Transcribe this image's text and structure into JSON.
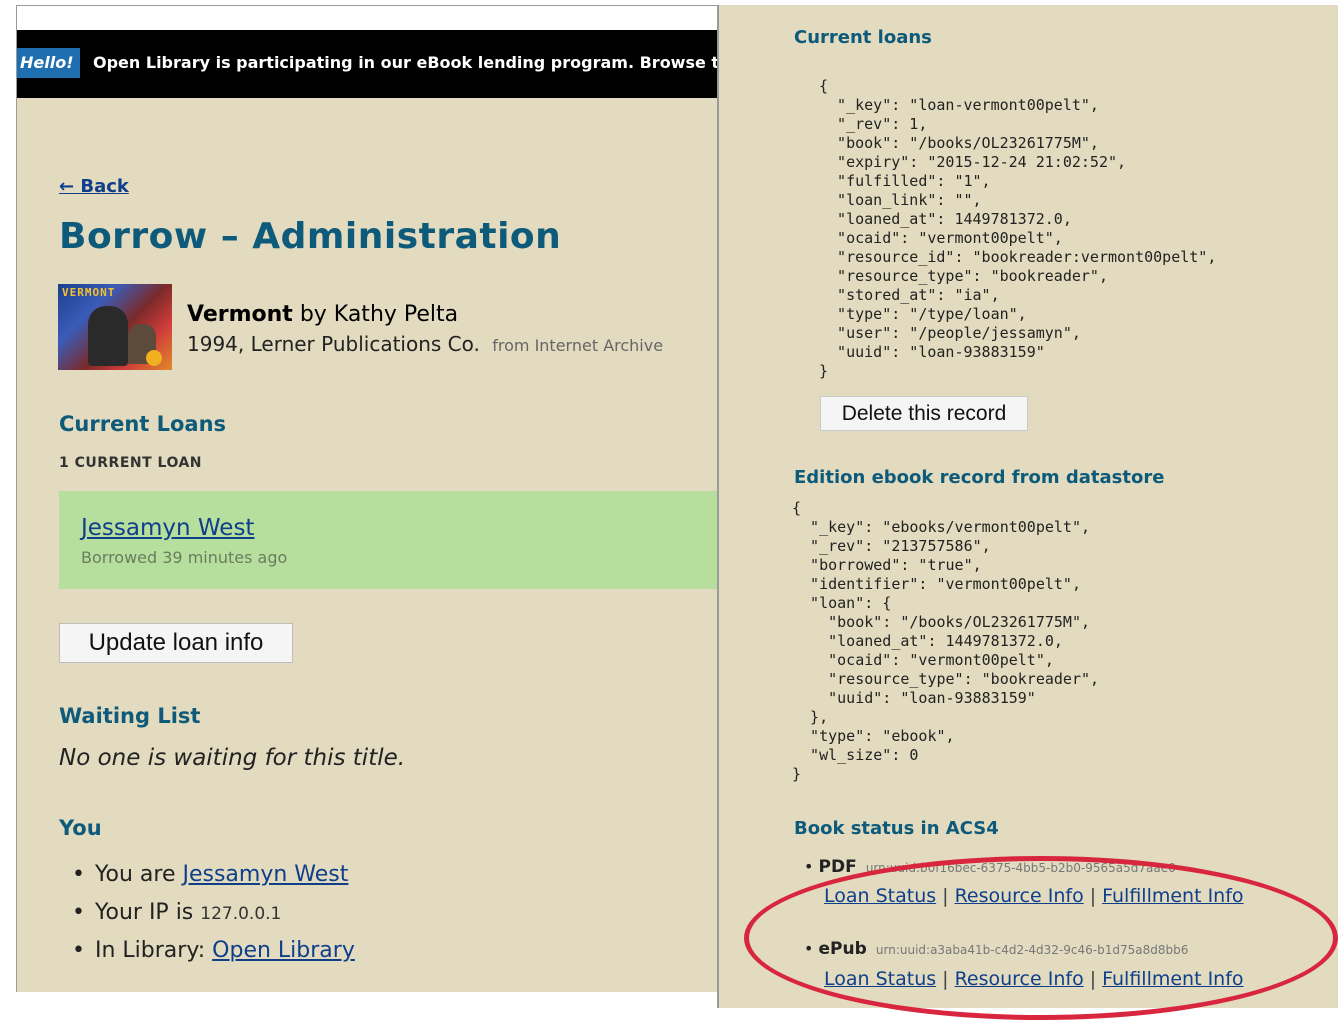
{
  "banner": {
    "hello": "Hello!",
    "message": "Open Library is participating in our eBook lending program. Browse th"
  },
  "nav": {
    "back": "← Back"
  },
  "page_title": "Borrow – Administration",
  "book": {
    "title": "Vermont",
    "by": "by Kathy Pelta",
    "publication": "1994, Lerner Publications Co.",
    "source": "from Internet Archive",
    "cover_text": "VERMONT"
  },
  "current_loans": {
    "heading": "Current Loans",
    "count": "1 CURRENT LOAN",
    "loan": {
      "user": "Jessamyn West",
      "time": "Borrowed 39 minutes ago"
    },
    "update_button": "Update loan info"
  },
  "waiting": {
    "heading": "Waiting List",
    "message": "No one is waiting for this title."
  },
  "you": {
    "heading": "You",
    "items": [
      {
        "prefix": "You are",
        "link": "Jessamyn West"
      },
      {
        "prefix": "Your IP is",
        "value": "127.0.0.1"
      },
      {
        "prefix": "In Library:",
        "link": "Open Library"
      }
    ]
  },
  "right": {
    "current_loans_heading": "Current loans",
    "loan_record": "{\n  \"_key\": \"loan-vermont00pelt\",\n  \"_rev\": 1,\n  \"book\": \"/books/OL23261775M\",\n  \"expiry\": \"2015-12-24 21:02:52\",\n  \"fulfilled\": \"1\",\n  \"loan_link\": \"\",\n  \"loaned_at\": 1449781372.0,\n  \"ocaid\": \"vermont00pelt\",\n  \"resource_id\": \"bookreader:vermont00pelt\",\n  \"resource_type\": \"bookreader\",\n  \"stored_at\": \"ia\",\n  \"type\": \"/type/loan\",\n  \"user\": \"/people/jessamyn\",\n  \"uuid\": \"loan-93883159\"\n}",
    "delete_button": "Delete this record",
    "edition_heading": "Edition ebook record from datastore",
    "edition_record": "{\n  \"_key\": \"ebooks/vermont00pelt\",\n  \"_rev\": \"213757586\",\n  \"borrowed\": \"true\",\n  \"identifier\": \"vermont00pelt\",\n  \"loan\": {\n    \"book\": \"/books/OL23261775M\",\n    \"loaned_at\": 1449781372.0,\n    \"ocaid\": \"vermont00pelt\",\n    \"resource_type\": \"bookreader\",\n    \"uuid\": \"loan-93883159\"\n  },\n  \"type\": \"ebook\",\n  \"wl_size\": 0\n}",
    "acs4_heading": "Book status in ACS4",
    "acs4": [
      {
        "format": "PDF",
        "urn": "urn:uuid:b0f16bec-6375-4bb5-b2b0-9565a5d7aae0"
      },
      {
        "format": "ePub",
        "urn": "urn:uuid:a3aba41b-c4d2-4d32-9c46-b1d75a8d8bb6"
      }
    ],
    "links": {
      "loan_status": "Loan Status",
      "resource_info": "Resource Info",
      "fulfillment_info": "Fulfillment Info",
      "separator": "|"
    }
  },
  "colors": {
    "panel_bg": "#e2dbbf",
    "heading": "#0d5a7a",
    "loan_box": "#b6df9e",
    "highlight": "#d8263e",
    "banner_bg": "#000000",
    "hello_bg": "#1f6fb0"
  }
}
